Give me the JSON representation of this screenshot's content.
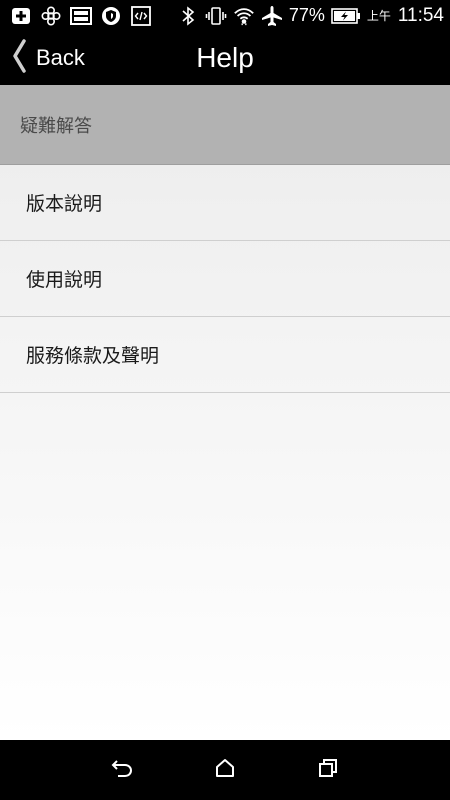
{
  "status_bar": {
    "battery_percent": "77%",
    "ampm": "上午",
    "time": "11:54",
    "icons": [
      "add-icon",
      "settings-flower-icon",
      "image-icon",
      "shield-icon",
      "code-icon",
      "bluetooth-icon",
      "vibrate-icon",
      "wifi-icon",
      "airplane-icon",
      "battery-charging-icon"
    ]
  },
  "header": {
    "back_label": "Back",
    "title": "Help"
  },
  "section": {
    "title": "疑難解答"
  },
  "items": [
    {
      "label": "版本說明"
    },
    {
      "label": "使用說明"
    },
    {
      "label": "服務條款及聲明"
    }
  ],
  "nav_bar": {
    "icons": [
      "back-nav-icon",
      "home-icon",
      "recents-icon"
    ]
  },
  "colors": {
    "bar_bg": "#000000",
    "section_bg": "#b2b2b2",
    "list_bg_top": "#ececec",
    "list_bg_bottom": "#ffffff"
  }
}
